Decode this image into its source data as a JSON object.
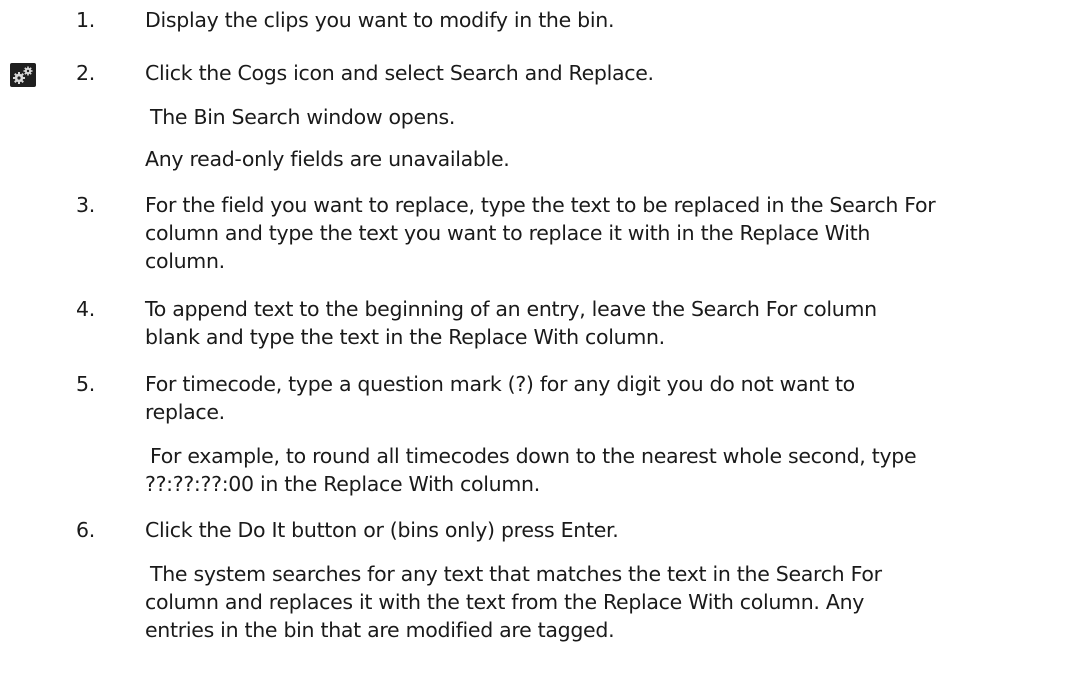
{
  "steps": [
    {
      "number": "1.",
      "text": "Display the clips you want to modify in the bin."
    },
    {
      "number": "2.",
      "text": "Click the Cogs icon and select Search and Replace.",
      "icon": "cogs-icon",
      "notes": [
        "The Bin Search window opens.",
        "Any read-only fields are unavailable."
      ]
    },
    {
      "number": "3.",
      "lines": [
        "For the field you want to replace, type the text to be replaced in the Search For",
        "column and type the text you want to replace it with in the Replace With",
        "column."
      ]
    },
    {
      "number": "4.",
      "lines": [
        "To append text to the beginning of an entry, leave the Search For column",
        "blank and type the text in the Replace With column."
      ]
    },
    {
      "number": "5.",
      "lines": [
        "For timecode, type a question mark (?) for any digit you do not want to",
        "replace."
      ],
      "note_lines": [
        "For example, to round all timecodes down to the nearest whole second, type",
        "??:??:??:00 in the Replace With column."
      ]
    },
    {
      "number": "6.",
      "text": "Click the Do It button or (bins only) press Enter.",
      "note_lines": [
        "The system searches for any text that matches the text in the Search For",
        "column and replaces it with the text from the Replace With column. Any",
        "entries in the bin that are modified are tagged."
      ]
    }
  ],
  "colors": {
    "text": "#1a1a1a",
    "icon_bg": "#1f1f1f",
    "icon_fg": "#d8d8d8"
  }
}
